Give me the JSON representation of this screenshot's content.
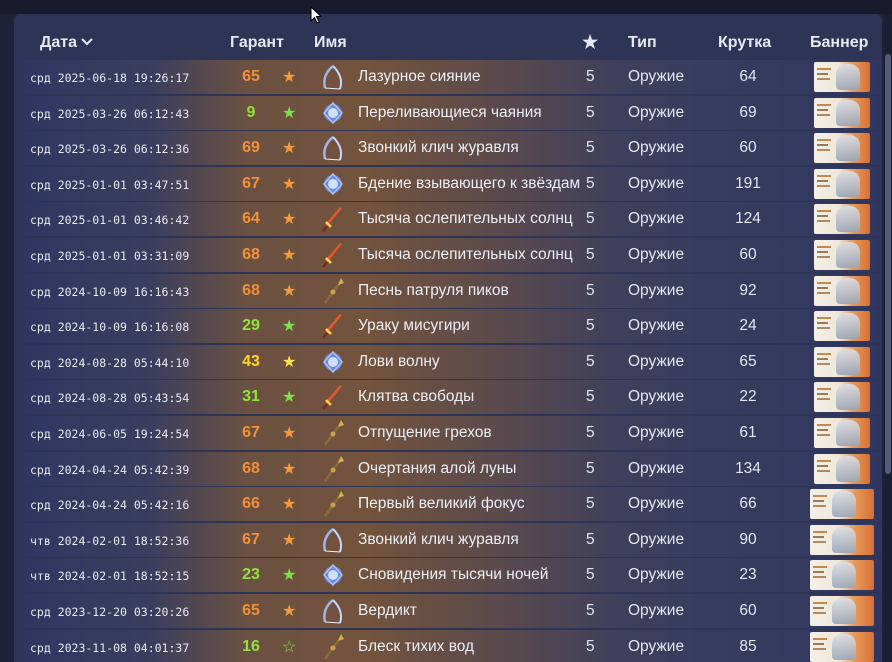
{
  "colors": {
    "pity_orange": "#f0913a",
    "pity_green": "#8fe33a",
    "pity_yellow": "#ffd52a",
    "star_orange": "#f39a3c",
    "star_green": "#7ee04a",
    "star_yellow": "#ffe04a"
  },
  "header": {
    "date": "Дата",
    "garant": "Гарант",
    "name": "Имя",
    "star": "★",
    "type": "Тип",
    "pull": "Крутка",
    "banner": "Баннер"
  },
  "rows": [
    {
      "date": "срд 2025-06-18 19:26:17",
      "pity": "65",
      "tier": "orange",
      "star": "★",
      "icon": "weapon-bow-icon",
      "name": "Лазурное сияние",
      "rarity": "5",
      "type": "Оружие",
      "pull": "64"
    },
    {
      "date": "срд 2025-03-26 06:12:43",
      "pity": "9",
      "tier": "green",
      "star": "★",
      "icon": "weapon-catalyst-icon",
      "name": "Переливающиеся чаяния",
      "rarity": "5",
      "type": "Оружие",
      "pull": "69"
    },
    {
      "date": "срд 2025-03-26 06:12:36",
      "pity": "69",
      "tier": "orange",
      "star": "★",
      "icon": "weapon-bow-icon",
      "name": "Звонкий клич журавля",
      "rarity": "5",
      "type": "Оружие",
      "pull": "60"
    },
    {
      "date": "срд 2025-01-01 03:47:51",
      "pity": "67",
      "tier": "orange",
      "star": "★",
      "icon": "weapon-catalyst-icon",
      "name": "Бдение взывающего к звёздам",
      "rarity": "5",
      "type": "Оружие",
      "pull": "191"
    },
    {
      "date": "срд 2025-01-01 03:46:42",
      "pity": "64",
      "tier": "orange",
      "star": "★",
      "icon": "weapon-sword-icon",
      "name": "Тысяча ослепительных солнц",
      "rarity": "5",
      "type": "Оружие",
      "pull": "124"
    },
    {
      "date": "срд 2025-01-01 03:31:09",
      "pity": "68",
      "tier": "orange",
      "star": "★",
      "icon": "weapon-sword-icon",
      "name": "Тысяча ослепительных солнц",
      "rarity": "5",
      "type": "Оружие",
      "pull": "60"
    },
    {
      "date": "срд 2024-10-09 16:16:43",
      "pity": "68",
      "tier": "orange",
      "star": "★",
      "icon": "weapon-polearm-icon",
      "name": "Песнь патруля пиков",
      "rarity": "5",
      "type": "Оружие",
      "pull": "92"
    },
    {
      "date": "срд 2024-10-09 16:16:08",
      "pity": "29",
      "tier": "green",
      "star": "★",
      "icon": "weapon-sword-icon",
      "name": "Ураку мисугири",
      "rarity": "5",
      "type": "Оружие",
      "pull": "24"
    },
    {
      "date": "срд 2024-08-28 05:44:10",
      "pity": "43",
      "tier": "yellow",
      "star": "★",
      "icon": "weapon-catalyst-icon",
      "name": "Лови волну",
      "rarity": "5",
      "type": "Оружие",
      "pull": "65"
    },
    {
      "date": "срд 2024-08-28 05:43:54",
      "pity": "31",
      "tier": "green",
      "star": "★",
      "icon": "weapon-sword-icon",
      "name": "Клятва свободы",
      "rarity": "5",
      "type": "Оружие",
      "pull": "22"
    },
    {
      "date": "срд 2024-06-05 19:24:54",
      "pity": "67",
      "tier": "orange",
      "star": "★",
      "icon": "weapon-polearm-icon",
      "name": "Отпущение грехов",
      "rarity": "5",
      "type": "Оружие",
      "pull": "61"
    },
    {
      "date": "срд 2024-04-24 05:42:39",
      "pity": "68",
      "tier": "orange",
      "star": "★",
      "icon": "weapon-polearm-icon",
      "name": "Очертания алой луны",
      "rarity": "5",
      "type": "Оружие",
      "pull": "134"
    },
    {
      "date": "срд 2024-04-24 05:42:16",
      "pity": "66",
      "tier": "orange",
      "star": "★",
      "icon": "weapon-polearm-icon",
      "name": "Первый великий фокус",
      "rarity": "5",
      "type": "Оружие",
      "pull": "66"
    },
    {
      "date": "чтв 2024-02-01 18:52:36",
      "pity": "67",
      "tier": "orange",
      "star": "★",
      "icon": "weapon-bow-icon",
      "name": "Звонкий клич журавля",
      "rarity": "5",
      "type": "Оружие",
      "pull": "90"
    },
    {
      "date": "чтв 2024-02-01 18:52:15",
      "pity": "23",
      "tier": "green",
      "star": "★",
      "icon": "weapon-catalyst-icon",
      "name": "Сновидения тысячи ночей",
      "rarity": "5",
      "type": "Оружие",
      "pull": "23"
    },
    {
      "date": "срд 2023-12-20 03:20:26",
      "pity": "65",
      "tier": "orange",
      "star": "★",
      "icon": "weapon-bow-icon",
      "name": "Вердикт",
      "rarity": "5",
      "type": "Оружие",
      "pull": "60"
    },
    {
      "date": "срд 2023-11-08 04:01:37",
      "pity": "16",
      "tier": "green",
      "star": "☆",
      "icon": "weapon-polearm-icon",
      "name": "Блеск тихих вод",
      "rarity": "5",
      "type": "Оружие",
      "pull": "85"
    }
  ]
}
